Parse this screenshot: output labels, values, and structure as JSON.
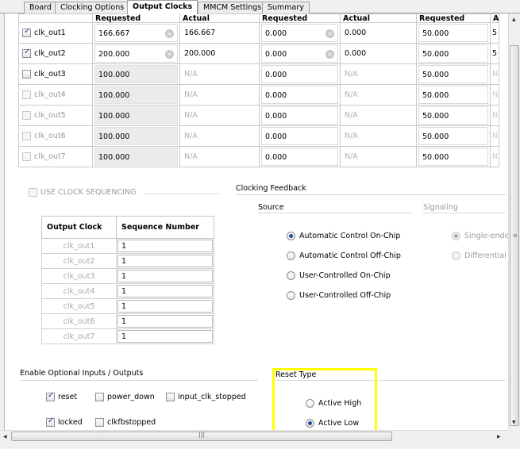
{
  "tabs": [
    {
      "label": "Board",
      "active": false
    },
    {
      "label": "Clocking Options",
      "active": false
    },
    {
      "label": "Output Clocks",
      "active": true
    },
    {
      "label": "MMCM Settings",
      "active": false
    },
    {
      "label": "Summary",
      "active": false
    }
  ],
  "clock_table": {
    "headers": [
      "Requested",
      "Actual",
      "Requested",
      "Actual",
      "Requested",
      "A"
    ],
    "rows": [
      {
        "name": "clk_out1",
        "checked": true,
        "enabled": true,
        "req1": "166.667",
        "act1": "166.667",
        "req2": "0.000",
        "act2": "0.000",
        "req3": "50.000",
        "cut": "5"
      },
      {
        "name": "clk_out2",
        "checked": true,
        "enabled": true,
        "req1": "200.000",
        "act1": "200.000",
        "req2": "0.000",
        "act2": "0.000",
        "req3": "50.000",
        "cut": "5"
      },
      {
        "name": "clk_out3",
        "checked": false,
        "enabled": true,
        "req1": "100.000",
        "act1": "N/A",
        "req2": "0.000",
        "act2": "N/A",
        "req3": "50.000",
        "cut": "N"
      },
      {
        "name": "clk_out4",
        "checked": false,
        "enabled": false,
        "req1": "100.000",
        "act1": "N/A",
        "req2": "0.000",
        "act2": "N/A",
        "req3": "50.000",
        "cut": "N"
      },
      {
        "name": "clk_out5",
        "checked": false,
        "enabled": false,
        "req1": "100.000",
        "act1": "N/A",
        "req2": "0.000",
        "act2": "N/A",
        "req3": "50.000",
        "cut": "N"
      },
      {
        "name": "clk_out6",
        "checked": false,
        "enabled": false,
        "req1": "100.000",
        "act1": "N/A",
        "req2": "0.000",
        "act2": "N/A",
        "req3": "50.000",
        "cut": "N"
      },
      {
        "name": "clk_out7",
        "checked": false,
        "enabled": false,
        "req1": "100.000",
        "act1": "N/A",
        "req2": "0.000",
        "act2": "N/A",
        "req3": "50.000",
        "cut": "N"
      }
    ]
  },
  "sequencing": {
    "label": "USE CLOCK SEQUENCING",
    "col_output_clock": "Output Clock",
    "col_sequence_number": "Sequence Number",
    "rows": [
      {
        "clock": "clk_out1",
        "seq": "1"
      },
      {
        "clock": "clk_out2",
        "seq": "1"
      },
      {
        "clock": "clk_out3",
        "seq": "1"
      },
      {
        "clock": "clk_out4",
        "seq": "1"
      },
      {
        "clock": "clk_out5",
        "seq": "1"
      },
      {
        "clock": "clk_out6",
        "seq": "1"
      },
      {
        "clock": "clk_out7",
        "seq": "1"
      }
    ]
  },
  "feedback": {
    "title": "Clocking Feedback",
    "source_label": "Source",
    "signaling_label": "Signaling",
    "source_options": [
      {
        "label": "Automatic Control On-Chip",
        "selected": true
      },
      {
        "label": "Automatic Control Off-Chip",
        "selected": false
      },
      {
        "label": "User-Controlled On-Chip",
        "selected": false
      },
      {
        "label": "User-Controlled Off-Chip",
        "selected": false
      }
    ],
    "signaling_options": [
      {
        "label": "Single-ende",
        "selected": true
      },
      {
        "label": "Differential",
        "selected": false
      }
    ]
  },
  "optional_io": {
    "title": "Enable Optional Inputs / Outputs",
    "items": [
      {
        "label": "reset",
        "checked": true
      },
      {
        "label": "power_down",
        "checked": false
      },
      {
        "label": "input_clk_stopped",
        "checked": false
      },
      {
        "label": "locked",
        "checked": true
      },
      {
        "label": "clkfbstopped",
        "checked": false
      }
    ]
  },
  "reset_type": {
    "title": "Reset Type",
    "options": [
      {
        "label": "Active High",
        "selected": false
      },
      {
        "label": "Active Low",
        "selected": true
      }
    ],
    "highlight_color": "#ffff00"
  },
  "icons": {
    "clear": "×",
    "arrow_up": "▲",
    "arrow_down": "▼",
    "arrow_left": "◀",
    "arrow_right": "▶",
    "grip_v": "≡",
    "grip_h": "|||"
  },
  "colors": {
    "selected_radio": "#1c4ea0",
    "highlight": "#ffff00"
  }
}
